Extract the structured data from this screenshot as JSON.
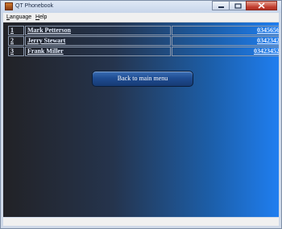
{
  "window": {
    "title": "QT Phonebook",
    "controls": {
      "minimize": "minimize-icon",
      "maximize": "maximize-icon",
      "close": "close-icon"
    }
  },
  "menu": {
    "items": [
      {
        "accelerator": "L",
        "rest": "anguage"
      },
      {
        "accelerator": "H",
        "rest": "elp"
      }
    ]
  },
  "contacts": {
    "rows": [
      {
        "index": "1",
        "name": "Mark Petterson",
        "phone": "03456564"
      },
      {
        "index": "2",
        "name": "Jerry Stewart",
        "phone": "03423423"
      },
      {
        "index": "3",
        "name": "Frank Miller",
        "phone": "034234524"
      }
    ]
  },
  "buttons": {
    "back": "Back to main menu"
  },
  "colors": {
    "content_gradient": [
      "#222226",
      "#25344d",
      "#1c5ea8",
      "#1f7ef0"
    ],
    "button": "#1f4d93",
    "close_button": "#c0392b"
  }
}
